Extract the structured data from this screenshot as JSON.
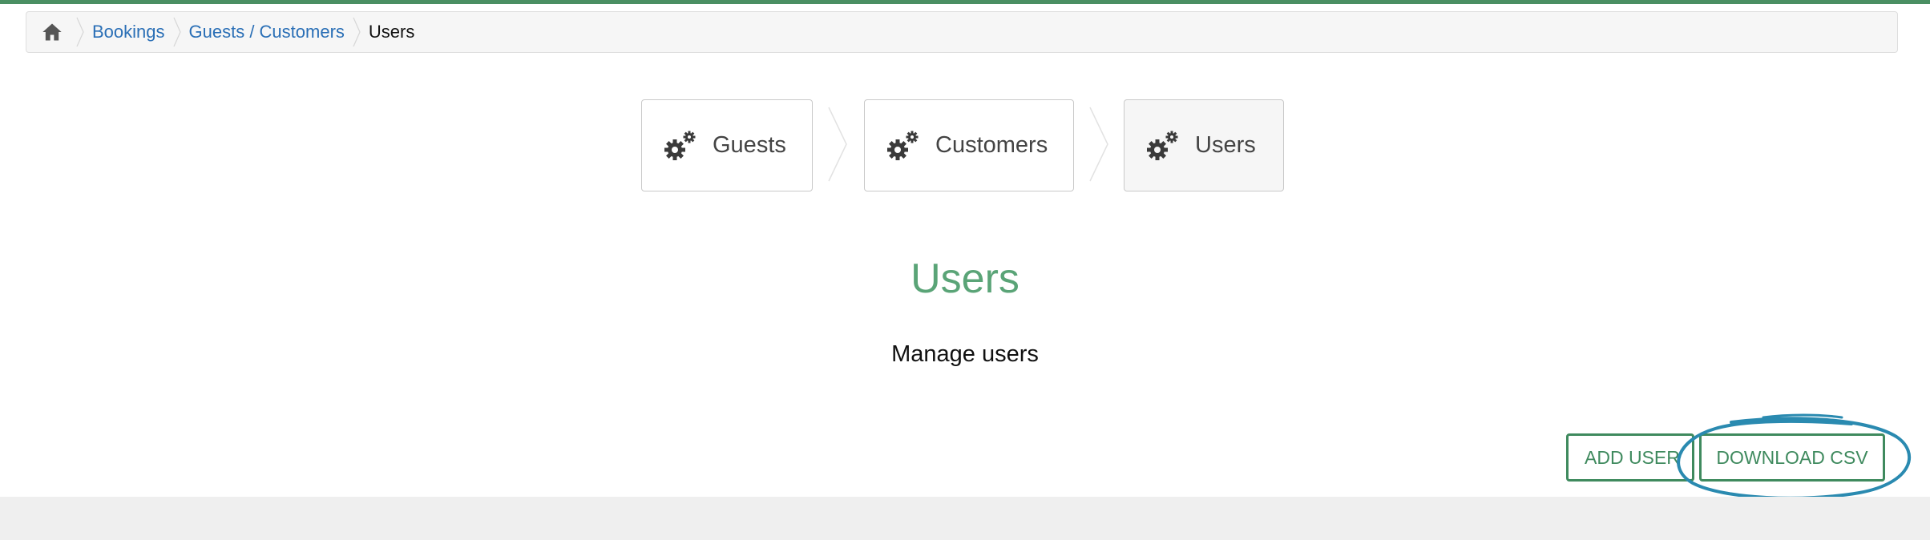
{
  "breadcrumb": {
    "home_icon": "home-icon",
    "items": [
      {
        "label": "Bookings"
      },
      {
        "label": "Guests / Customers"
      }
    ],
    "current": "Users"
  },
  "steps": [
    {
      "label": "Guests",
      "icon": "gears-icon",
      "active": false
    },
    {
      "label": "Customers",
      "icon": "gears-icon",
      "active": false
    },
    {
      "label": "Users",
      "icon": "gears-icon",
      "active": true
    }
  ],
  "page": {
    "title": "Users",
    "subtitle": "Manage users"
  },
  "actions": {
    "add_user": "ADD USER",
    "download_csv": "DOWNLOAD CSV"
  },
  "colors": {
    "accent_green": "#5aa477",
    "button_green": "#3f8a5e",
    "link_blue": "#2a6fb6",
    "annotation_blue": "#2a8ab0"
  }
}
